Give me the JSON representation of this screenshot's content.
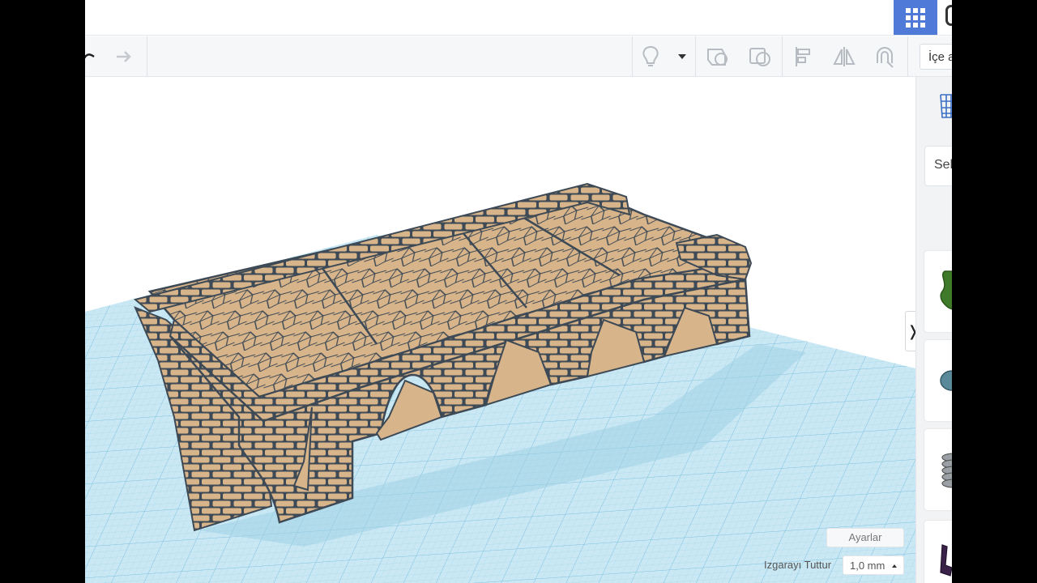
{
  "toolbar": {
    "import_label": "İçe a",
    "icons": [
      "undo-icon",
      "redo-icon",
      "lightbulb-icon",
      "dropdown-caret-icon",
      "group-icon",
      "ungroup-icon",
      "align-icon",
      "mirror-icon",
      "magnet-icon"
    ]
  },
  "right_panel": {
    "search_placeholder": "Sek",
    "view_icon": "workplane-grid-icon",
    "shape_thumbnails": [
      "green-blob-shape",
      "teal-rock-shape",
      "grey-coil-shape",
      "purple-shape"
    ]
  },
  "viewport": {
    "settings_label": "Ayarlar",
    "snap_grid_label": "Izgarayı Tuttur",
    "snap_grid_value": "1,0 mm",
    "model": "stone arch bridge",
    "model_color": "#d8b48a",
    "grid_color": "#c9e8f4"
  },
  "colors": {
    "accent": "#4f7ad8",
    "toolbar_bg": "#f6f7f9",
    "model_outline": "#3d4a56"
  }
}
